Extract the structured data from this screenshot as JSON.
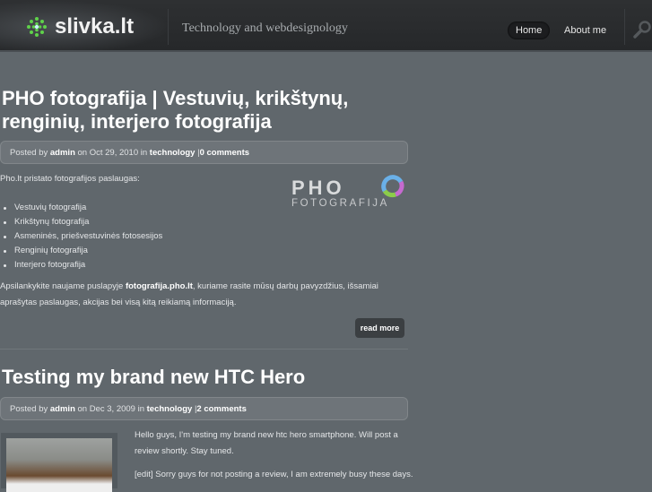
{
  "header": {
    "site_name": "slivka.lt",
    "tagline": "Technology and webdesignology",
    "nav": [
      {
        "label": "Home"
      },
      {
        "label": "About me"
      }
    ]
  },
  "posts": [
    {
      "title": "PHO fotografija | Vestuvių, krikštynų, renginių, interjero fotografija",
      "meta": {
        "posted_by": "Posted by",
        "author": "admin",
        "on": "on Oct 29, 2010 in",
        "category": "technology",
        "sep": "|",
        "comments": "0 comments"
      },
      "intro": "Pho.lt pristato fotografijos paslaugas:",
      "logo_text": "PHO",
      "logo_subtext": "FOTOGRAFIJA",
      "list": [
        "Vestuvių fotografija",
        "Krikštynų fotografija",
        "Asmeninės, priešvestuvinės fotosesijos",
        "Renginių fotografija",
        "Interjero fotografija"
      ],
      "outro_pre": "Apsilankykite naujame puslapyje ",
      "outro_link": "fotografija.pho.lt",
      "outro_post": ", kuriame rasite mūsų darbų pavyzdžius, išsamiai aprašytas paslaugas, akcijas bei visą kitą reikiamą informaciją.",
      "read_more": "read more"
    },
    {
      "title": "Testing my brand new HTC Hero",
      "meta": {
        "posted_by": "Posted by",
        "author": "admin",
        "on": "on Dec 3, 2009 in",
        "category": "technology",
        "sep": "|",
        "comments": "2 comments"
      },
      "p1": "Hello guys, I'm testing my brand new htc hero smartphone. Will post a review shortly. Stay tuned.",
      "p2": "[edit] Sorry guys for not posting a review, I am extremely busy these days."
    }
  ]
}
